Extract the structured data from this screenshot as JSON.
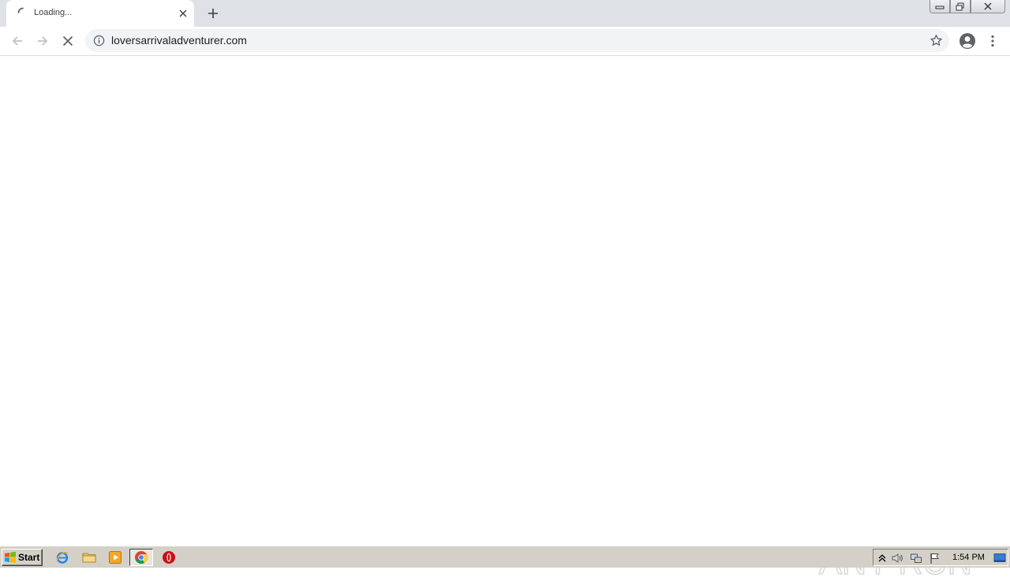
{
  "browser": {
    "tab": {
      "title": "Loading...",
      "close_icon": "close-icon",
      "spinner_icon": "loading-spinner-icon"
    },
    "new_tab_icon": "plus-icon",
    "window_controls": [
      "minimize-icon",
      "restore-icon",
      "close-icon"
    ],
    "toolbar": {
      "back_icon": "arrow-left-icon",
      "forward_icon": "arrow-right-icon",
      "stop_icon": "close-icon",
      "url": "loversarrivaladventurer.com",
      "site_info_icon": "info-icon",
      "bookmark_icon": "star-icon",
      "profile_icon": "account-circle-icon",
      "menu_icon": "vertical-dots-icon"
    }
  },
  "page": {
    "watermark_text": "ANY RUN"
  },
  "taskbar": {
    "start_label": "Start",
    "pinned": [
      "ie-icon",
      "folder-icon",
      "media-player-icon",
      "chrome-icon",
      "opera-icon"
    ],
    "tray_icons": [
      "chevron-up-icon",
      "speaker-icon",
      "network-icon",
      "flag-icon",
      "show-desktop-icon"
    ],
    "clock": "1:54 PM"
  },
  "colors": {
    "tabstrip_bg": "#dee1e6",
    "omnibox_bg": "#f1f3f4",
    "taskbar_bg": "#d4d0c8",
    "icon_gray": "#5f6368"
  }
}
